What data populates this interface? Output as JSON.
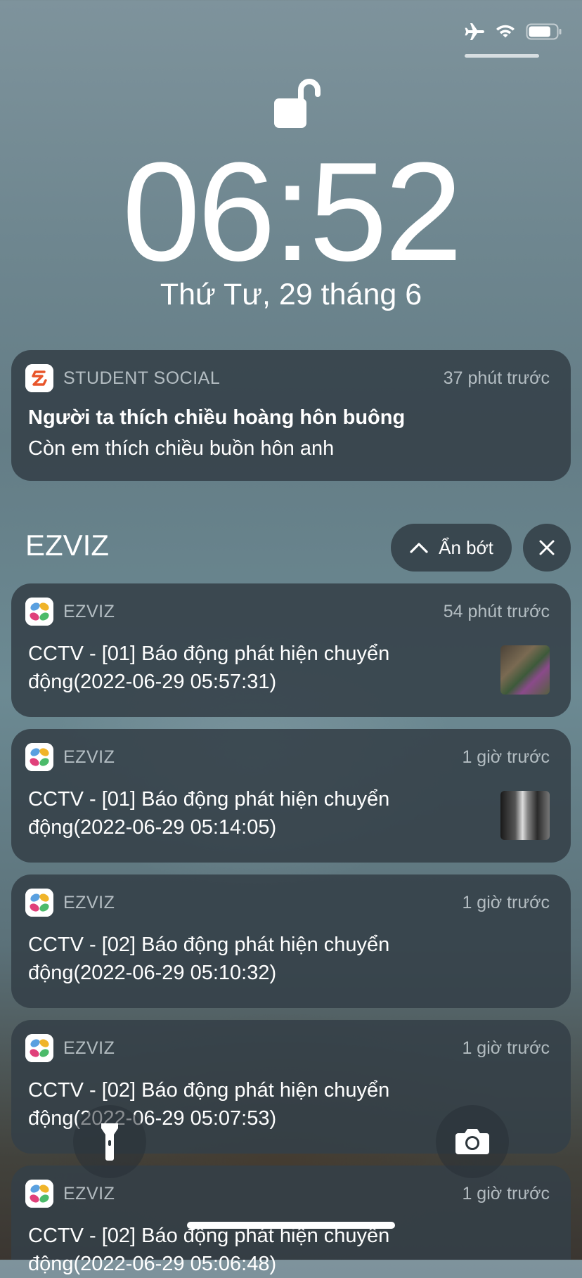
{
  "status_bar": {
    "icons": [
      "airplane-icon",
      "wifi-icon",
      "battery-icon"
    ],
    "battery_level": 0.8
  },
  "lock_screen": {
    "time": "06:52",
    "date": "Thứ Tư, 29 tháng 6"
  },
  "featured_notification": {
    "app": "STUDENT SOCIAL",
    "time_ago": "37 phút trước",
    "title": "Người ta thích chiều hoàng hôn buông",
    "body": "Còn em thích chiều buồn hôn anh"
  },
  "group": {
    "name": "EZVIZ",
    "show_less_label": "Ẩn bớt",
    "notifications": [
      {
        "app": "EZVIZ",
        "time_ago": "54 phút trước",
        "line1": "CCTV - [01] Báo động phát hiện chuyển",
        "line2": "động(2022-06-29 05:57:31)",
        "has_thumbnail": true
      },
      {
        "app": "EZVIZ",
        "time_ago": "1 giờ trước",
        "line1": "CCTV - [01] Báo động phát hiện chuyển",
        "line2": "động(2022-06-29 05:14:05)",
        "has_thumbnail": true
      },
      {
        "app": "EZVIZ",
        "time_ago": "1 giờ trước",
        "line1": "CCTV - [02] Báo động phát hiện chuyển",
        "line2": "động(2022-06-29 05:10:32)",
        "has_thumbnail": false
      },
      {
        "app": "EZVIZ",
        "time_ago": "1 giờ trước",
        "line1": "CCTV - [02] Báo động phát hiện chuyển",
        "line2": "động(2022-06-29 05:07:53)",
        "has_thumbnail": false
      },
      {
        "app": "EZVIZ",
        "time_ago": "1 giờ trước",
        "line1": "CCTV - [02] Báo động phát hiện chuyển",
        "line2": "động(2022-06-29 05:06:48)",
        "has_thumbnail": false
      }
    ]
  },
  "quick_actions": [
    "flashlight-icon",
    "camera-icon"
  ]
}
